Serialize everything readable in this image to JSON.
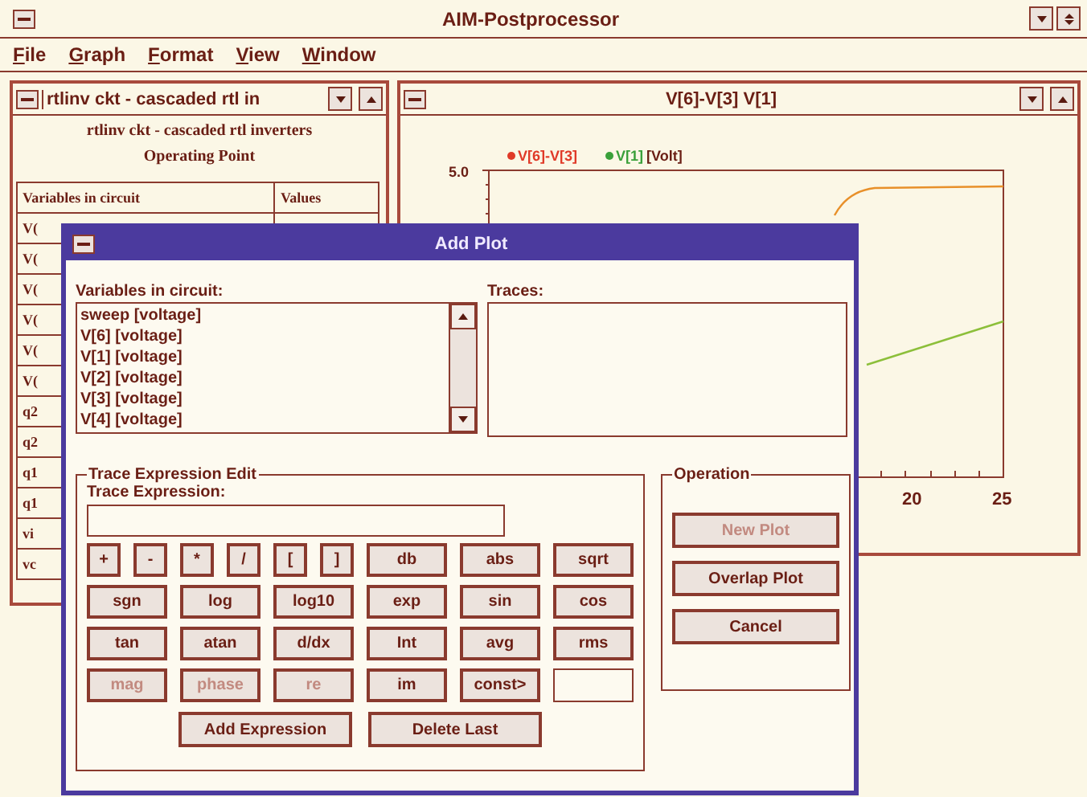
{
  "window": {
    "title": "AIM-Postprocessor"
  },
  "menu": [
    {
      "label": "File"
    },
    {
      "label": "Graph"
    },
    {
      "label": "Format"
    },
    {
      "label": "View"
    },
    {
      "label": "Window"
    }
  ],
  "circuit_window": {
    "title": "rtlinv ckt - cascaded rtl in",
    "heading": "rtlinv ckt - cascaded rtl inverters",
    "subheading": "Operating Point",
    "columns": [
      "Variables in circuit",
      "Values"
    ],
    "rows": [
      "V(",
      "V(",
      "V(",
      "V(",
      "V(",
      "V(",
      "q2",
      "q2",
      "q1",
      "q1",
      "vi",
      "vc"
    ]
  },
  "graph_window": {
    "title": "V[6]-V[3] V[1]",
    "legend": [
      {
        "label": "V[6]-V[3]",
        "color": "#e03a28"
      },
      {
        "label": "V[1]",
        "color": "#3aa03a"
      }
    ],
    "unit": "[Volt]",
    "y_tick": "5.0",
    "x_ticks": [
      "20",
      "25"
    ]
  },
  "dialog": {
    "title": "Add Plot",
    "variables_label": "Variables in circuit:",
    "variables": [
      {
        "label": "sweep [voltage]"
      },
      {
        "label": "V[6] [voltage]"
      },
      {
        "label": "V[1] [voltage]"
      },
      {
        "label": "V[2] [voltage]"
      },
      {
        "label": "V[3] [voltage]"
      },
      {
        "label": "V[4] [voltage]"
      }
    ],
    "traces_label": "Traces:",
    "expression_group": "Trace Expression Edit",
    "expression_label": "Trace Expression:",
    "keypad": [
      [
        {
          "label": "+",
          "kind": "key",
          "disabled": false
        },
        {
          "label": "-",
          "kind": "key",
          "disabled": false
        },
        {
          "label": "*",
          "kind": "key",
          "disabled": false
        },
        {
          "label": "/",
          "kind": "key",
          "disabled": false
        },
        {
          "label": "[",
          "kind": "key",
          "disabled": false
        },
        {
          "label": "]",
          "kind": "key",
          "disabled": false
        },
        {
          "label": "db",
          "kind": "function",
          "disabled": false
        },
        {
          "label": "abs",
          "kind": "function",
          "disabled": false
        },
        {
          "label": "sqrt",
          "kind": "function",
          "disabled": false
        }
      ],
      [
        {
          "label": "sgn",
          "kind": "function",
          "disabled": false
        },
        {
          "label": "log",
          "kind": "function",
          "disabled": false
        },
        {
          "label": "log10",
          "kind": "function",
          "disabled": false
        },
        {
          "label": "exp",
          "kind": "function",
          "disabled": false
        },
        {
          "label": "sin",
          "kind": "function",
          "disabled": false
        },
        {
          "label": "cos",
          "kind": "function",
          "disabled": false
        }
      ],
      [
        {
          "label": "tan",
          "kind": "function",
          "disabled": false
        },
        {
          "label": "atan",
          "kind": "function",
          "disabled": false
        },
        {
          "label": "d/dx",
          "kind": "function",
          "disabled": false
        },
        {
          "label": "Int",
          "kind": "function",
          "disabled": false
        },
        {
          "label": "avg",
          "kind": "function",
          "disabled": false
        },
        {
          "label": "rms",
          "kind": "function",
          "disabled": false
        }
      ],
      [
        {
          "label": "mag",
          "kind": "function",
          "disabled": true
        },
        {
          "label": "phase",
          "kind": "function",
          "disabled": true
        },
        {
          "label": "re",
          "kind": "function",
          "disabled": true
        },
        {
          "label": "im",
          "kind": "function",
          "disabled": false
        },
        {
          "label": "const>",
          "kind": "function",
          "disabled": false
        },
        {
          "kind": "field"
        }
      ]
    ],
    "expression_buttons": [
      {
        "label": "Add Expression",
        "disabled": false
      },
      {
        "label": "Delete Last",
        "disabled": false
      }
    ],
    "operation_group": "Operation",
    "operation_buttons": [
      {
        "label": "New Plot",
        "disabled": true
      },
      {
        "label": "Overlap Plot",
        "disabled": false
      },
      {
        "label": "Cancel",
        "disabled": false
      }
    ]
  }
}
